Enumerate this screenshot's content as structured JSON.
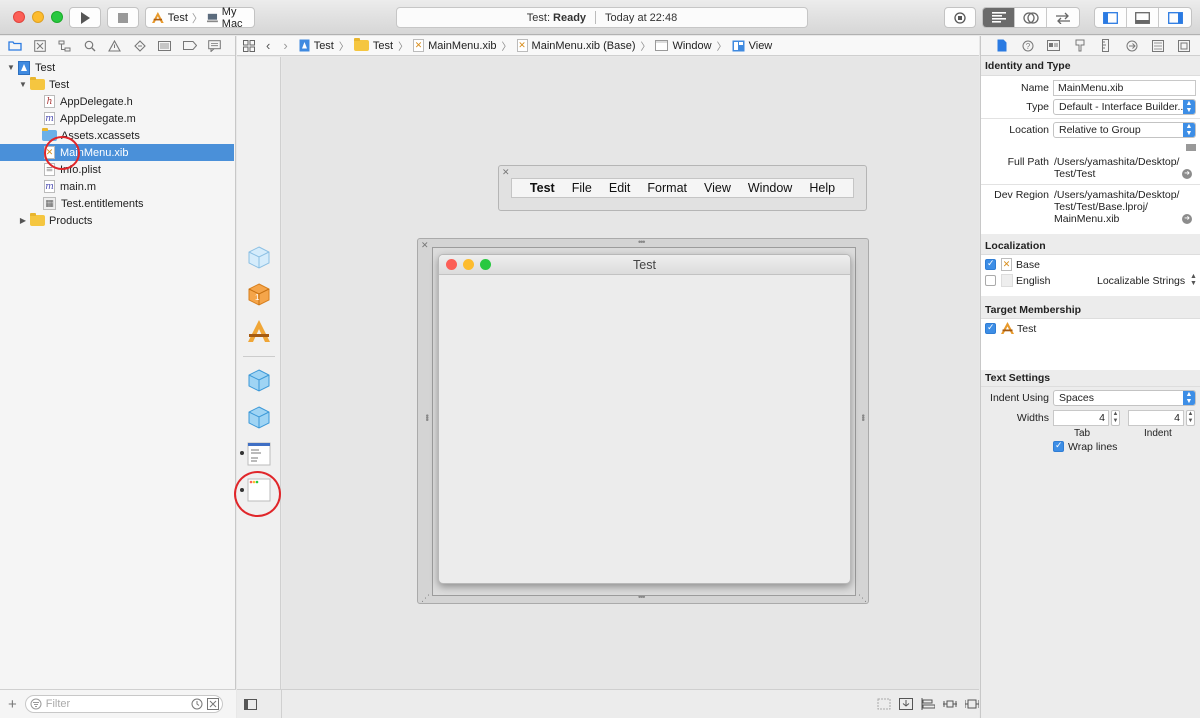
{
  "toolbar": {
    "scheme_target": "Test",
    "device": "My Mac",
    "activity_project": "Test:",
    "activity_status": "Ready",
    "activity_time": "Today at 22:48"
  },
  "navigator": {
    "project": "Test",
    "group": "Test",
    "files": [
      {
        "name": "AppDelegate.h",
        "icon": "h"
      },
      {
        "name": "AppDelegate.m",
        "icon": "m"
      },
      {
        "name": "Assets.xcassets",
        "icon": "assets"
      },
      {
        "name": "MainMenu.xib",
        "icon": "xib"
      },
      {
        "name": "Info.plist",
        "icon": "plist"
      },
      {
        "name": "main.m",
        "icon": "m"
      },
      {
        "name": "Test.entitlements",
        "icon": "entitlements"
      }
    ],
    "products": "Products",
    "filter_placeholder": "Filter"
  },
  "jumpbar": {
    "crumbs": [
      "Test",
      "Test",
      "MainMenu.xib",
      "MainMenu.xib (Base)",
      "Window",
      "View"
    ]
  },
  "canvas": {
    "menu_items": [
      "Test",
      "File",
      "Edit",
      "Format",
      "View",
      "Window",
      "Help"
    ],
    "window_title": "Test"
  },
  "inspector": {
    "identity": {
      "header": "Identity and Type",
      "name_label": "Name",
      "name_value": "MainMenu.xib",
      "type_label": "Type",
      "type_value": "Default - Interface Builder...",
      "location_label": "Location",
      "location_value": "Relative to Group",
      "fullpath_label": "Full Path",
      "fullpath_line1": "/Users/yamashita/Desktop/",
      "fullpath_line2": "Test/Test",
      "devregion_label": "Dev Region",
      "devregion_line1": "/Users/yamashita/Desktop/",
      "devregion_line2": "Test/Test/Base.lproj/",
      "devregion_line3": "MainMenu.xib"
    },
    "localization": {
      "header": "Localization",
      "base": "Base",
      "english": "English",
      "english_type": "Localizable Strings"
    },
    "membership": {
      "header": "Target Membership",
      "target": "Test"
    },
    "text_settings": {
      "header": "Text Settings",
      "indent_label": "Indent Using",
      "indent_value": "Spaces",
      "widths_label": "Widths",
      "tab_value": "4",
      "indent_width_value": "4",
      "tab_caption": "Tab",
      "indent_caption": "Indent",
      "wrap_label": "Wrap lines"
    }
  },
  "colors": {
    "selection": "#4a90d9",
    "accent": "#3d8ee6",
    "annotation": "#e0262a"
  }
}
